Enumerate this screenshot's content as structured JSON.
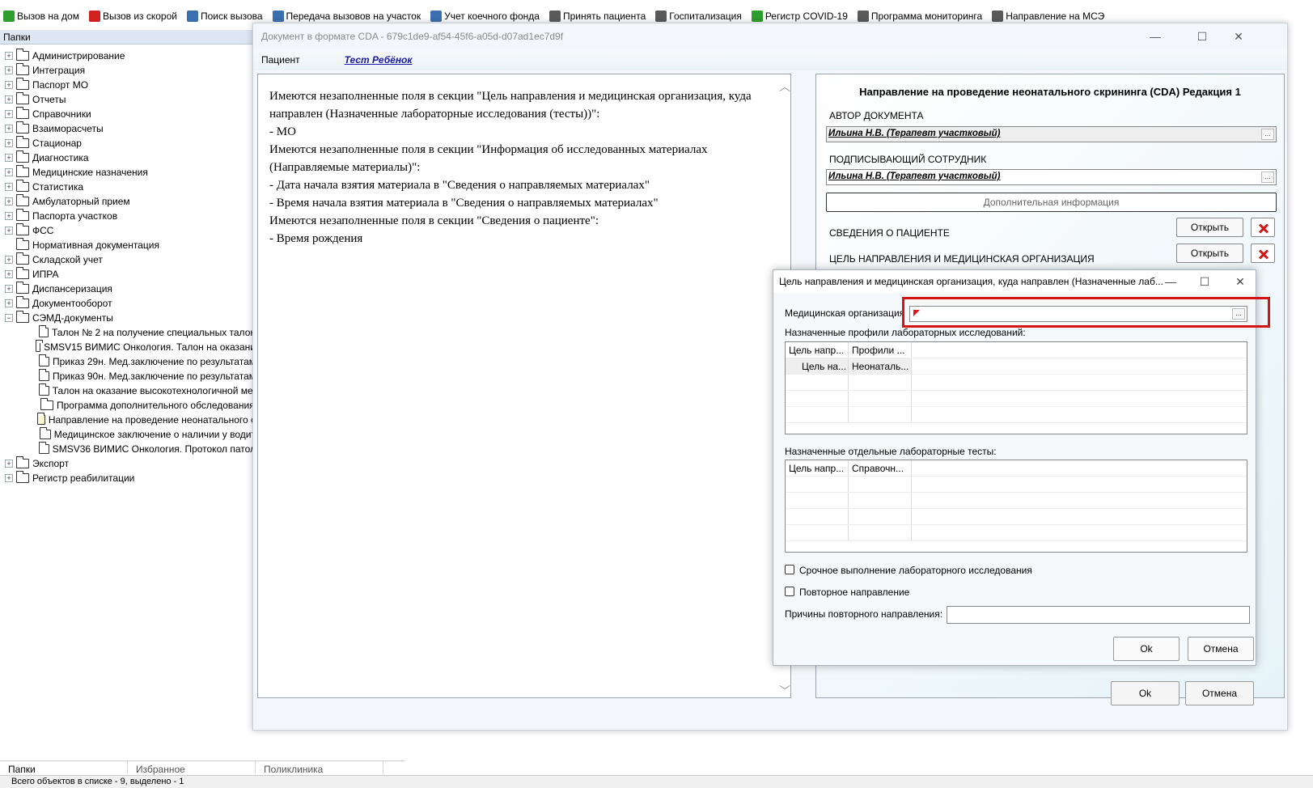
{
  "toolbar": {
    "items": [
      {
        "label": "Вызов на дом",
        "icon": "home-call-icon",
        "color": "#2e9e2e"
      },
      {
        "label": "Вызов из скорой",
        "icon": "ambulance-call-icon",
        "color": "#d02020"
      },
      {
        "label": "Поиск вызова",
        "icon": "search-call-icon",
        "color": "#3c6fb0"
      },
      {
        "label": "Передача вызовов на участок",
        "icon": "transfer-call-icon",
        "color": "#3c6fb0"
      },
      {
        "label": "Учет коечного фонда",
        "icon": "bed-fund-icon",
        "color": "#3c6fb0"
      },
      {
        "label": "Принять пациента",
        "icon": "accept-patient-icon",
        "color": "#5a5a5a"
      },
      {
        "label": "Госпитализация",
        "icon": "hospitalization-icon",
        "color": "#5a5a5a"
      },
      {
        "label": "Регистр COVID-19",
        "icon": "covid-icon",
        "color": "#2e9e2e"
      },
      {
        "label": "Программа мониторинга",
        "icon": "monitoring-icon",
        "color": "#5a5a5a"
      },
      {
        "label": "Направление на МСЭ",
        "icon": "mse-referral-icon",
        "color": "#5a5a5a"
      }
    ]
  },
  "folders": {
    "header": "Папки",
    "items": [
      {
        "label": "Администрирование",
        "level": 0,
        "expander": "+"
      },
      {
        "label": "Интеграция",
        "level": 0,
        "expander": "+"
      },
      {
        "label": "Паспорт МО",
        "level": 0,
        "expander": "+"
      },
      {
        "label": "Отчеты",
        "level": 0,
        "expander": "+"
      },
      {
        "label": "Справочники",
        "level": 0,
        "expander": "+"
      },
      {
        "label": "Взаиморасчеты",
        "level": 0,
        "expander": "+"
      },
      {
        "label": "Стационар",
        "level": 0,
        "expander": "+"
      },
      {
        "label": "Диагностика",
        "level": 0,
        "expander": "+"
      },
      {
        "label": "Медицинские назначения",
        "level": 0,
        "expander": "+"
      },
      {
        "label": "Статистика",
        "level": 0,
        "expander": "+"
      },
      {
        "label": "Амбулаторный прием",
        "level": 0,
        "expander": "+"
      },
      {
        "label": "Паспорта участков",
        "level": 0,
        "expander": "+"
      },
      {
        "label": "ФСС",
        "level": 0,
        "expander": "+"
      },
      {
        "label": "Нормативная документация",
        "level": 0,
        "expander": ""
      },
      {
        "label": "Складской учет",
        "level": 0,
        "expander": "+"
      },
      {
        "label": "ИПРА",
        "level": 0,
        "expander": "+"
      },
      {
        "label": "Диспансеризация",
        "level": 0,
        "expander": "+"
      },
      {
        "label": "Документооборот",
        "level": 0,
        "expander": "+"
      },
      {
        "label": "СЭМД-документы",
        "level": 0,
        "expander": "−"
      },
      {
        "label": "Талон № 2 на получение специальных талон",
        "level": 1,
        "expander": ""
      },
      {
        "label": "SMSV15 ВИМИС Онкология. Талон на оказани",
        "level": 1,
        "expander": ""
      },
      {
        "label": "Приказ 29н. Мед.заключение по результатам",
        "level": 1,
        "expander": ""
      },
      {
        "label": "Приказ 90н. Мед.заключение по результатам",
        "level": 1,
        "expander": ""
      },
      {
        "label": "Талон на оказание высокотехнологичной ме,",
        "level": 1,
        "expander": ""
      },
      {
        "label": "Программа дополнительного обследования",
        "level": 1,
        "expander": ""
      },
      {
        "label": "Направление на проведение неонатального с",
        "level": 1,
        "expander": "",
        "open": true
      },
      {
        "label": "Медицинское заключение о наличии у водит",
        "level": 1,
        "expander": ""
      },
      {
        "label": "SMSV36 ВИМИС Онкология. Протокол патол",
        "level": 1,
        "expander": ""
      },
      {
        "label": "Экспорт",
        "level": 0,
        "expander": "+"
      },
      {
        "label": "Регистр реабилитации",
        "level": 0,
        "expander": "+"
      }
    ]
  },
  "bottom_tabs": [
    {
      "label": "Папки",
      "active": true
    },
    {
      "label": "Избранное",
      "active": false
    },
    {
      "label": "Поликлиника",
      "active": false
    }
  ],
  "statusbar": {
    "text": "Всего объектов в списке - 9, выделено - 1"
  },
  "cda_window": {
    "title": "Документ в формате CDA - 679c1de9-af54-45f6-a05d-d07ad1ec7d9f",
    "patient_label": "Пациент",
    "patient_name": "Тест Ребёнок",
    "messages": [
      "Имеются незаполненные поля в секции \"Цель направления и медицинская организация, куда направлен (Назначенные лабораторные исследования (тесты))\":",
      "- МО",
      "Имеются незаполненные поля в секции \"Информация об исследованных материалах (Направляемые материалы)\":",
      "- Дата начала взятия материала в \"Сведения о направляемых материалах\"",
      "- Время начала взятия материала в \"Сведения о направляемых материалах\"",
      "Имеются незаполненные поля в секции \"Сведения о пациенте\":",
      "- Время рождения"
    ],
    "form": {
      "title": "Направление на проведение неонатального скрининга (CDA) Редакция 1",
      "author_label": "АВТОР ДОКУМЕНТА",
      "author_value": "Ильина Н.В. (Терапевт участковый)",
      "signer_label": "ПОДПИСЫВАЮЩИЙ СОТРУДНИК",
      "signer_value": "Ильина Н.В. (Терапевт участковый)",
      "additional_info": "Дополнительная информация",
      "patient_section": "СВЕДЕНИЯ О ПАЦИЕНТЕ",
      "goal_section": "ЦЕЛЬ НАПРАВЛЕНИЯ И МЕДИЦИНСКАЯ ОРГАНИЗАЦИЯ",
      "open_label": "Открыть",
      "dots_label": "..."
    },
    "ok_label": "Ok",
    "cancel_label": "Отмена",
    "window_controls": {
      "minimize": "—",
      "maximize": "☐",
      "close": "✕"
    }
  },
  "dialog": {
    "title": "Цель направления и медицинская организация, куда направлен (Назначенные лаб...",
    "med_org_label": "Медицинская организация",
    "med_org_value": "",
    "profiles_label": "Назначенные профили лабораторных исследований:",
    "profiles_headers": [
      "Цель напр...",
      "Профили ..."
    ],
    "profiles_rows": [
      [
        "Цель на...",
        "Неонаталь..."
      ]
    ],
    "tests_label": "Назначенные отдельные лабораторные тесты:",
    "tests_headers": [
      "Цель напр...",
      "Справочн..."
    ],
    "urgent_label": "Срочное выполнение лабораторного исследования",
    "urgent_checked": false,
    "repeat_label": "Повторное направление",
    "repeat_checked": false,
    "repeat_reason_label": "Причины повторного направления:",
    "repeat_reason_value": "",
    "ok_label": "Ok",
    "cancel_label": "Отмена",
    "dots_label": "...",
    "window_controls": {
      "minimize": "—",
      "maximize": "☐",
      "close": "✕"
    }
  },
  "colors": {
    "highlight": "#d41414",
    "link": "#1a1aa6",
    "delete_x": "#d01818"
  }
}
